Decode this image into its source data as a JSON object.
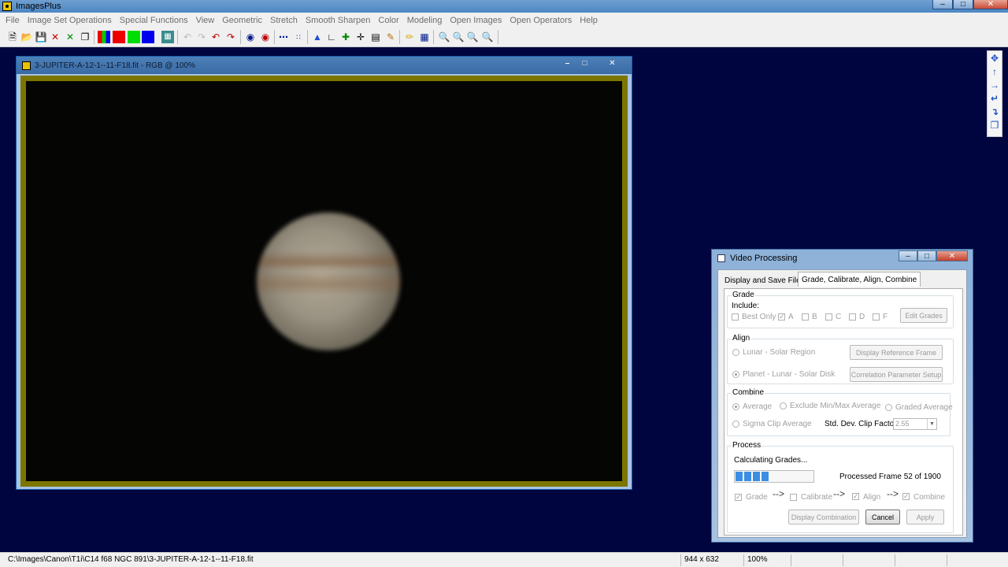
{
  "app": {
    "title": "ImagesPlus"
  },
  "menu": [
    "File",
    "Image Set Operations",
    "Special Functions",
    "View",
    "Geometric",
    "Stretch",
    "Smooth Sharpen",
    "Color",
    "Modeling",
    "Open Images",
    "Open Operators",
    "Help"
  ],
  "toolbar_icons": [
    "new-file-icon",
    "open-file-icon",
    "save-icon",
    "close-x-red-icon",
    "close-x-green-icon",
    "copy-icon",
    "rgb-channels-icon",
    "red-channel-icon",
    "green-channel-icon",
    "blue-channel-icon",
    "grid-icon",
    "undo-disabled-icon",
    "redo-disabled-icon",
    "undo-icon",
    "redo-icon",
    "record-icon",
    "record-alt-icon",
    "dots-icon",
    "points-icon",
    "triangle-icon",
    "angle-icon",
    "plus-icon",
    "crosshair-icon",
    "select-icon",
    "paint-icon",
    "pencil-icon",
    "table-icon",
    "zoom-in-icon",
    "zoom-out-icon",
    "zoom-fit-icon",
    "zoom-actual-icon"
  ],
  "side_tool_icons": [
    "move-icon",
    "arrow-up-icon",
    "arrow-right-icon",
    "rotate-left-icon",
    "rotate-right-icon",
    "copy-page-icon"
  ],
  "image_window": {
    "title": "3-JUPITER-A-12-1--11-F18.fit - RGB @ 100%"
  },
  "colors": {
    "desktop_bg": "#01053f",
    "frame": "#7c7600"
  },
  "dialog": {
    "title": "Video Processing",
    "tabs": [
      "Display and Save Files",
      "Grade, Calibrate, Align, Combine"
    ],
    "grade": {
      "legend": "Grade",
      "include_label": "Include:",
      "best_only": "Best Only",
      "a": "A",
      "b": "B",
      "c": "C",
      "d": "D",
      "f": "F",
      "edit_grades": "Edit Grades"
    },
    "align": {
      "legend": "Align",
      "lunar_solar_region": "Lunar - Solar Region",
      "planet_lunar_solar_disk": "Planet - Lunar - Solar Disk",
      "display_reference_frame": "Display Reference Frame",
      "correlation_setup": "Correlation Parameter Setup"
    },
    "combine": {
      "legend": "Combine",
      "average": "Average",
      "exclude_minmax": "Exclude Min/Max Average",
      "graded_average": "Graded Average",
      "sigma_clip": "Sigma Clip Average",
      "clip_factor_label": "Std. Dev. Clip Factor:",
      "clip_factor_value": "2.55"
    },
    "process": {
      "legend": "Process",
      "status": "Calculating Grades...",
      "progress": 0.04,
      "frame_text": "Processed Frame 52 of 1900",
      "grade": "Grade",
      "calibrate": "Calibrate",
      "align": "Align",
      "combine": "Combine",
      "arrow": "-->",
      "display_combination": "Display Combination",
      "cancel": "Cancel",
      "apply": "Apply"
    }
  },
  "status": {
    "path": "C:\\Images\\Canon\\T1i\\C14 f68 NGC 891\\3-JUPITER-A-12-1--11-F18.fit",
    "dimensions": "944 x 632",
    "zoom": "100%"
  }
}
